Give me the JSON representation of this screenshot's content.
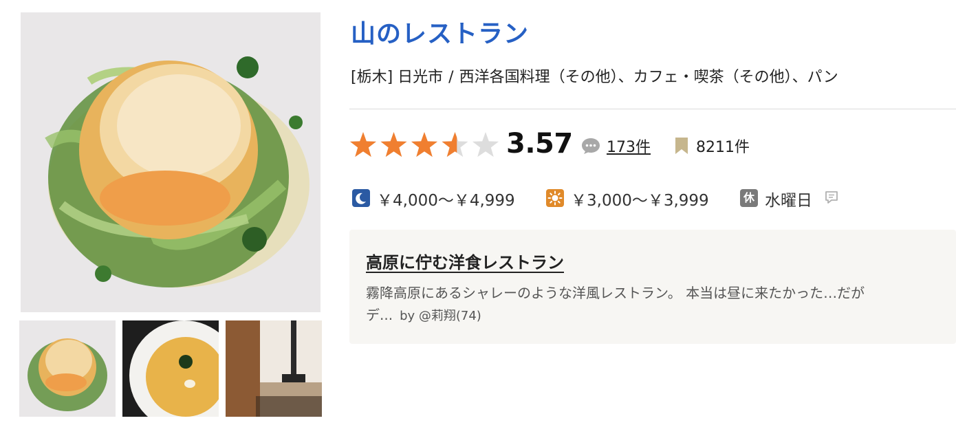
{
  "restaurant": {
    "name": "山のレストラン",
    "area": "[栃木] 日光市",
    "separator": "/",
    "genres": "西洋各国料理（その他）、カフェ・喫茶（その他）、パン"
  },
  "rating": {
    "score": "3.57",
    "stars_value": 3.57,
    "stars_max": 5,
    "review_count": "173件",
    "bookmark_count": "8211件"
  },
  "budget": {
    "dinner": "￥4,000～￥4,999",
    "lunch": "￥3,000～￥3,999",
    "holiday_icon_label": "休",
    "holiday": "水曜日"
  },
  "pr": {
    "title": "高原に佇む洋食レストラン",
    "line1": "霧降高原にあるシャレーのような洋風レストラン。 本当は昼に来たかった…だが",
    "line2": "デ...",
    "byline": "by @莉翔(74)"
  },
  "icons": {
    "dinner": "moon-icon",
    "lunch": "sun-icon",
    "holiday": "closed-day-icon",
    "review": "speech-bubble-icon",
    "bookmark": "bookmark-icon",
    "holiday_note": "comment-note-icon"
  },
  "colors": {
    "title": "#2660c4",
    "star_filled": "#f07f30",
    "star_empty": "#dddddd",
    "pr_background": "#f7f6f3"
  }
}
